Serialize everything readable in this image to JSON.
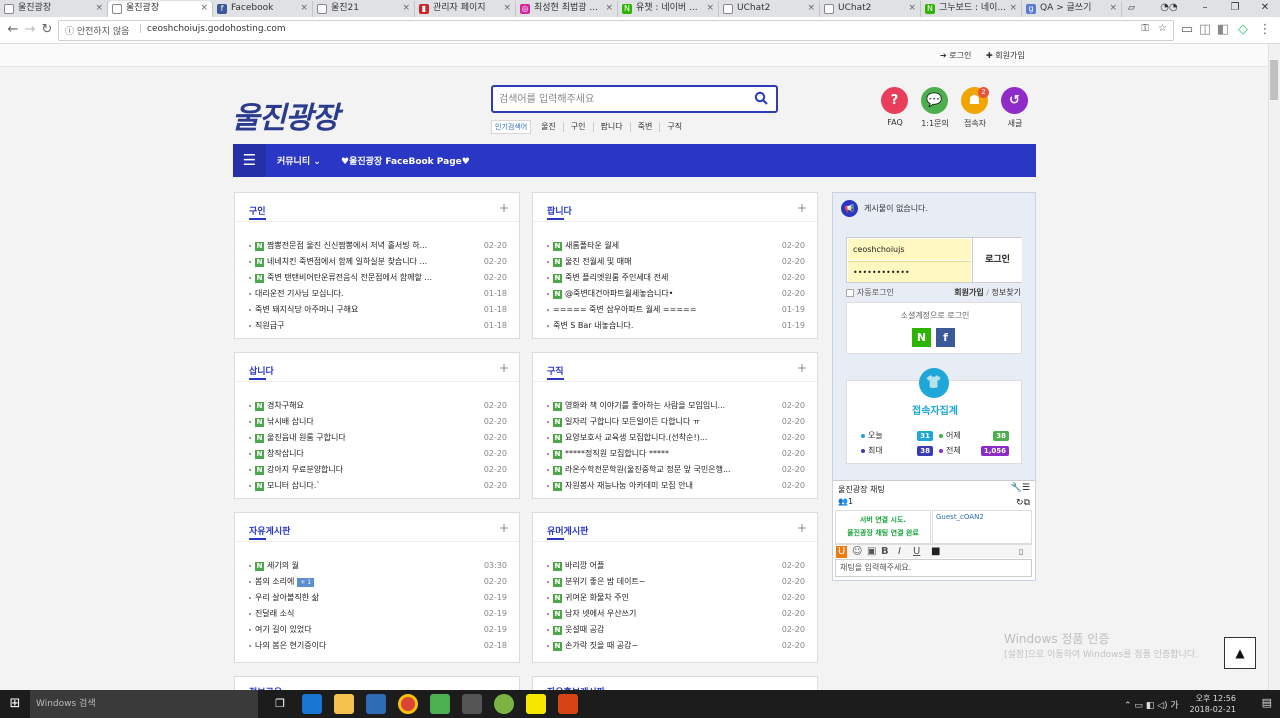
{
  "browser": {
    "tabs": [
      {
        "label": "울진광장",
        "icon": "page-icon",
        "active": false
      },
      {
        "label": "울진광장",
        "icon": "page-icon",
        "active": true
      },
      {
        "label": "Facebook",
        "icon": "facebook-icon",
        "active": false
      },
      {
        "label": "울진21",
        "icon": "page-icon",
        "active": false
      },
      {
        "label": "관리자 페이지",
        "icon": "admin-icon",
        "active": false
      },
      {
        "label": "최성현 최법광 ...",
        "icon": "instagram-icon",
        "active": false
      },
      {
        "label": "유챗 : 네이버 ...",
        "icon": "naver-icon",
        "active": false
      },
      {
        "label": "UChat2",
        "icon": "page-icon",
        "active": false
      },
      {
        "label": "UChat2",
        "icon": "page-icon",
        "active": false
      },
      {
        "label": "그누보드 : 네이...",
        "icon": "naver-icon",
        "active": false
      },
      {
        "label": "QA > 글쓰기",
        "icon": "qa-icon",
        "active": false
      }
    ],
    "security": "안전하지 않음",
    "url": "ceoshchoiujs.godohosting.com"
  },
  "util": {
    "login": "로그인",
    "join": "회원가입"
  },
  "header": {
    "logo": "울진광장",
    "search_placeholder": "검색어를 입력해주세요",
    "popular_label": "인기검색어",
    "popular": [
      "울진",
      "구인",
      "팝니다",
      "죽변",
      "구직"
    ],
    "quick": [
      {
        "label": "FAQ",
        "icon": "question-icon",
        "color": "#e83e5c"
      },
      {
        "label": "1:1문의",
        "icon": "chat-bubble-icon",
        "color": "#4cae4c"
      },
      {
        "label": "접속자",
        "icon": "users-icon",
        "color": "#f0a500"
      },
      {
        "label": "새글",
        "icon": "new-post-icon",
        "color": "#8e2bc9"
      }
    ],
    "visitor_badge": "2"
  },
  "nav": {
    "community": "커뮤니티",
    "facebook": "♥울진광장 FaceBook Page♥"
  },
  "boards": [
    {
      "title": "구인",
      "items": [
        {
          "text": "짬뽕전문점 울진 신신짬뽕에서 저녁 홀서빙 하...",
          "date": "02-20",
          "new": true
        },
        {
          "text": "네네치킨 죽변점에서 함께 일하실분 찾습니다 ...",
          "date": "02-20",
          "new": true
        },
        {
          "text": "죽변 탠탠비어탄운류전음식 전문점에서 함께할 ...",
          "date": "02-20",
          "new": true
        },
        {
          "text": "대리운전 기사님 모십니다.",
          "date": "01-18",
          "new": false
        },
        {
          "text": "죽변 돼지식당 아주머니 구해요",
          "date": "01-18",
          "new": false
        },
        {
          "text": "직원급구",
          "date": "01-18",
          "new": false
        }
      ]
    },
    {
      "title": "팝니다",
      "items": [
        {
          "text": " 새롬폴타운 월세",
          "date": "02-20",
          "new": true
        },
        {
          "text": "울진 전월세 및 매매",
          "date": "02-20",
          "new": true
        },
        {
          "text": "죽변 플리엣원룸 주인세대 전세",
          "date": "02-20",
          "new": true
        },
        {
          "text": "@죽변대건아파트월세놓습니다•",
          "date": "02-20",
          "new": true
        },
        {
          "text": "===== 죽변 삼우아파트 월세 =====",
          "date": "01-19",
          "new": false
        },
        {
          "text": "죽변 S Bar 내놓습니다.",
          "date": "01-19",
          "new": false
        }
      ]
    },
    {
      "title": "삽니다",
      "items": [
        {
          "text": "경차구해요",
          "date": "02-20",
          "new": true
        },
        {
          "text": "낚시배 삽니다",
          "date": "02-20",
          "new": true
        },
        {
          "text": " 울진읍내 원룸 구합니다",
          "date": "02-20",
          "new": true
        },
        {
          "text": "창작삽니다",
          "date": "02-20",
          "new": true
        },
        {
          "text": "강아지 무료분양합니다",
          "date": "02-20",
          "new": true
        },
        {
          "text": "모니터 삽니다.`",
          "date": "02-20",
          "new": true
        }
      ]
    },
    {
      "title": "구직",
      "items": [
        {
          "text": "영화와 책 이야기를 좋아하는 사람을 모입입니...",
          "date": "02-20",
          "new": true
        },
        {
          "text": "일자리 구합니다 모든일이든 다합니다 ㅠ",
          "date": "02-20",
          "new": true
        },
        {
          "text": " 요양보호사 교육생 모집합니다.(선착순!)...",
          "date": "02-20",
          "new": true
        },
        {
          "text": "*****정직원 모집합니다 *****",
          "date": "02-20",
          "new": true
        },
        {
          "text": "라온수학전문학원(울진중학교 정문 앞 국민은행...",
          "date": "02-20",
          "new": true
        },
        {
          "text": "자원봉사 재능나눔 아카데미 모집 안내",
          "date": "02-20",
          "new": true
        }
      ]
    },
    {
      "title": "자유게시판",
      "items": [
        {
          "text": "세기의 월",
          "date": "03:30",
          "new": true,
          "count": ""
        },
        {
          "text": "봄의 소리에",
          "date": "02-20",
          "new": false,
          "count": "+ 1"
        },
        {
          "text": "우리 살아볼직한 삶",
          "date": "02-19",
          "new": false,
          "count": ""
        },
        {
          "text": "진달래 소식",
          "date": "02-19",
          "new": false,
          "count": ""
        },
        {
          "text": "여기 길이 있었다",
          "date": "02-19",
          "new": false,
          "count": ""
        },
        {
          "text": "나의 봄은 현기증이다",
          "date": "02-18",
          "new": false,
          "count": ""
        }
      ]
    },
    {
      "title": "유머게시판",
      "items": [
        {
          "text": "바리깡 어플",
          "date": "02-20",
          "new": true
        },
        {
          "text": "분위기 좋은 밤 데이트~",
          "date": "02-20",
          "new": true
        },
        {
          "text": "귀여운 화물차 주인",
          "date": "02-20",
          "new": true
        },
        {
          "text": "남자 넷에서 우산쓰기",
          "date": "02-20",
          "new": true
        },
        {
          "text": "웃설때 공감",
          "date": "02-20",
          "new": true
        },
        {
          "text": "손가락 짓을 때 공감~",
          "date": "02-20",
          "new": true
        }
      ]
    }
  ],
  "more_boards": [
    "정보공유",
    "자유홍보게시판"
  ],
  "sidebar": {
    "notice": "게시물이 없습니다.",
    "user_id": "ceoshchoiujs",
    "password_mask": "••••••••••••",
    "login_button": "로그인",
    "auto_login": "자동로그인",
    "join": "회원가입",
    "slash": "/",
    "find": "정보찾기",
    "social_title": "소셜계정으로 로그인",
    "stats_title": "접속자집계",
    "stats": {
      "today_label": "오늘",
      "today": "31",
      "yesterday_label": "어제",
      "yesterday": "38",
      "max_label": "최대",
      "max": "38",
      "total_label": "전체",
      "total": "1,056"
    },
    "chat": {
      "title": "울진광장 채팅",
      "user_count": "1",
      "msg1": "서버 연결 시도.",
      "msg2": "울진광장 채팅 연결 완료",
      "guest": "Guest_cOAN2",
      "placeholder": "채팅을 입력해주세요."
    }
  },
  "watermark": {
    "title": "Windows 정품 인증",
    "sub": "[설정]으로 이동하여 Windows를 정품 인증합니다."
  },
  "taskbar": {
    "search": "Windows 검색",
    "time": "오후 12:56",
    "date": "2018-02-21"
  }
}
